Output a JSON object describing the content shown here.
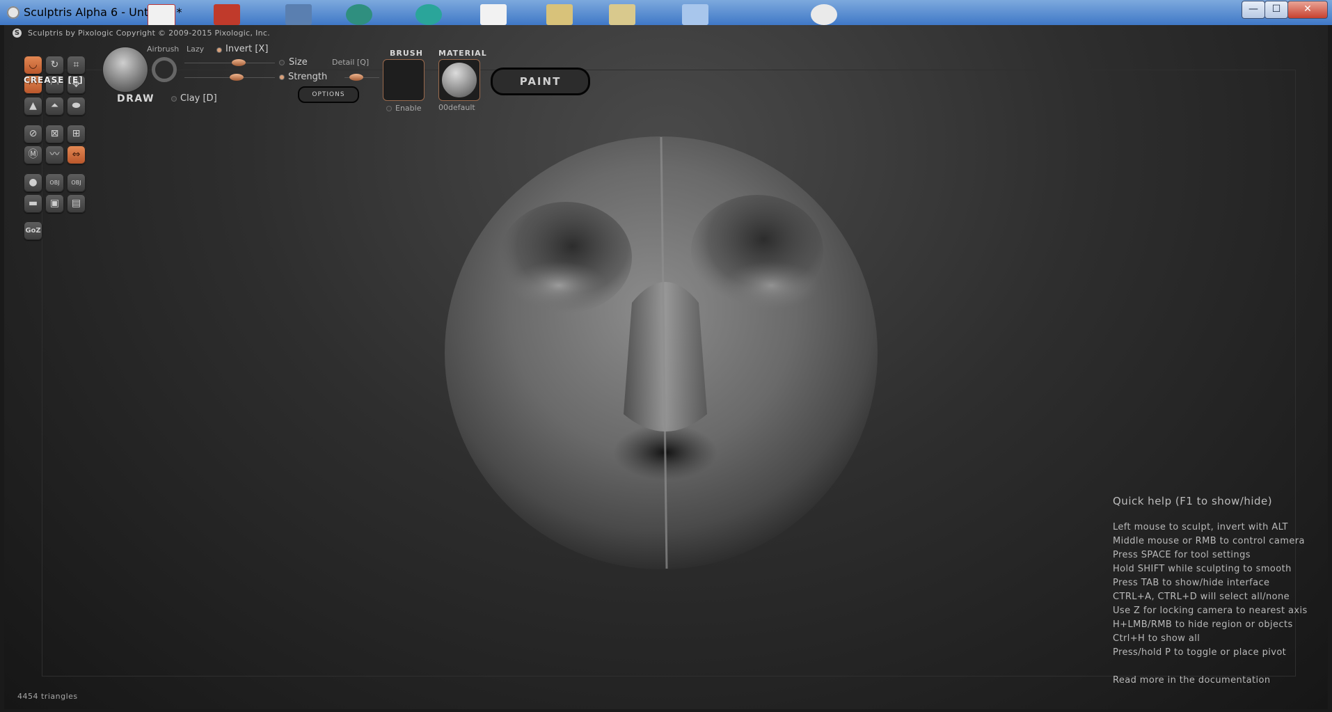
{
  "window": {
    "title": "Sculptris Alpha 6 - Untitled *",
    "minimize_glyph": "—",
    "maximize_glyph": "☐",
    "close_glyph": "✕"
  },
  "app": {
    "copyright": "Sculptris by Pixologic   Copyright © 2009-2015 Pixologic, Inc.",
    "logo_glyph": "S"
  },
  "tools": {
    "active_tool_label": "CREASE [E]",
    "goz_label": "GoZ",
    "obj_label": "OBJ"
  },
  "brush_panel": {
    "tool_name": "DRAW",
    "airbrush_label": "Airbrush",
    "lazy_label": "Lazy",
    "invert_label": "Invert [X]",
    "size_label": "Size",
    "strength_label": "Strength",
    "detail_label": "Detail [Q]",
    "clay_label": "Clay [D]",
    "options_label": "OPTIONS",
    "brush_title": "BRUSH",
    "enable_label": "Enable",
    "material_title": "MATERIAL",
    "material_name": "00default",
    "paint_label": "PAINT"
  },
  "quick_help": {
    "title": "Quick help (F1 to show/hide)",
    "lines": [
      "Left mouse to sculpt, invert with ALT",
      "Middle mouse or RMB to control camera",
      "Press SPACE for tool settings",
      "Hold SHIFT while sculpting to smooth",
      "Press TAB to show/hide interface",
      "CTRL+A, CTRL+D will select all/none",
      "Use Z for locking camera to nearest axis",
      "H+LMB/RMB to hide region or objects",
      "Ctrl+H to show all",
      "Press/hold P to toggle or place pivot"
    ],
    "docs_link": "Read more in the documentation"
  },
  "status": {
    "triangles": "4454 triangles"
  },
  "colors": {
    "accent": "#d9824f",
    "titlebar": "#4a82cf"
  }
}
